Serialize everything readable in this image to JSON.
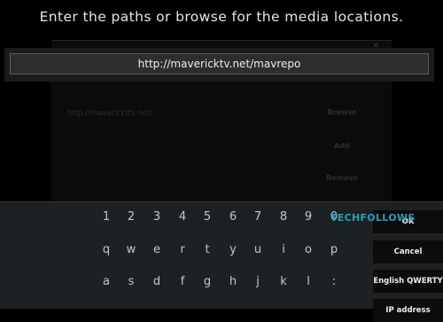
{
  "dialog": {
    "heading": "Enter the paths or browse for the media locations.",
    "background_path": "http://maverickttv.net/",
    "background_buttons": [
      "Browse",
      "Add",
      "Remove"
    ],
    "close_glyph": "✕"
  },
  "input": {
    "value": "http://mavericktv.net/mavrepo"
  },
  "keyboard": {
    "rows": [
      [
        "1",
        "2",
        "3",
        "4",
        "5",
        "6",
        "7",
        "8",
        "9",
        "0"
      ],
      [
        "q",
        "w",
        "e",
        "r",
        "t",
        "y",
        "u",
        "i",
        "o",
        "p"
      ],
      [
        "a",
        "s",
        "d",
        "f",
        "g",
        "h",
        "j",
        "k",
        "l",
        ":"
      ]
    ],
    "side_buttons": [
      "OK",
      "Cancel",
      "English QWERTY",
      "IP address"
    ]
  },
  "watermark": "TECHFOLLOWS",
  "colors": {
    "watermark": "#2a9fb3",
    "keyboard_bg": "#1d2124"
  }
}
